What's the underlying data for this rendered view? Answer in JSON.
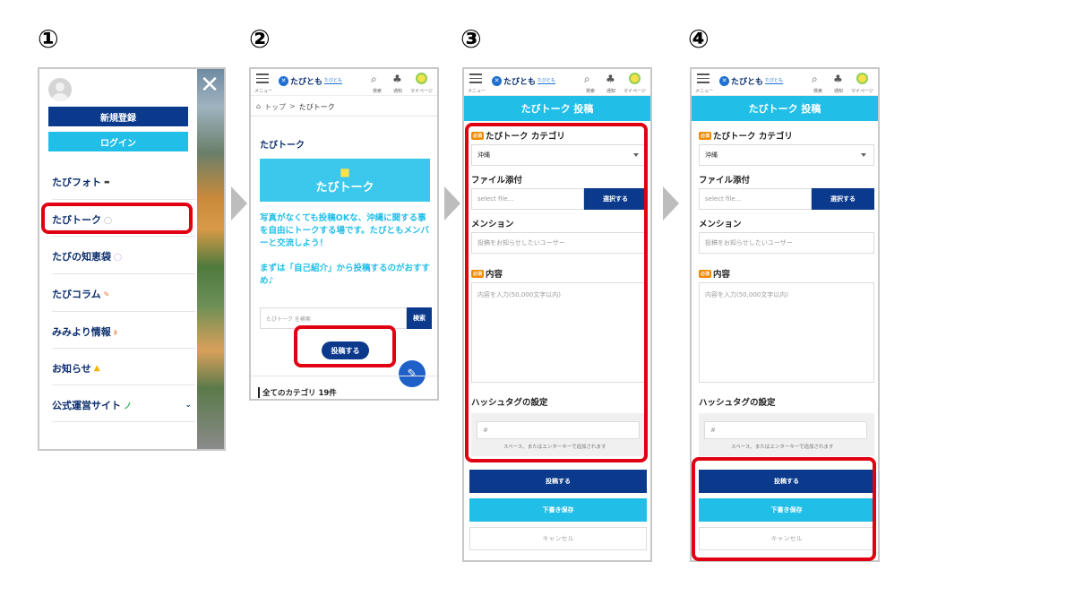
{
  "steps": [
    "①",
    "②",
    "③",
    "④"
  ],
  "panel1": {
    "signup_label": "新規登録",
    "login_label": "ログイン",
    "menu_items": [
      {
        "label": "たびフォト",
        "icon": "camera-icon"
      },
      {
        "label": "たびトーク",
        "icon": "speech-bubble-icon"
      },
      {
        "label": "たびの知恵袋",
        "icon": "bubble-icon"
      },
      {
        "label": "たびコラム",
        "icon": "pen-icon"
      },
      {
        "label": "みみより情報",
        "icon": "ear-icon"
      },
      {
        "label": "お知らせ",
        "icon": "bell-icon"
      },
      {
        "label": "公式運営サイト",
        "icon": "leaf-icon"
      }
    ],
    "close_icon": "close-icon"
  },
  "header": {
    "menu_label": "メニュー",
    "logo_text": "たびとも",
    "logo_sub": "たびとも",
    "search_label": "検索",
    "notify_label": "通知",
    "mypage_label": "マイページ"
  },
  "panel2": {
    "breadcrumb_home": "トップ",
    "breadcrumb_sep": ">",
    "breadcrumb_current": "たびトーク",
    "section_title": "たびトーク",
    "banner_text": "たびトーク",
    "description": "写真がなくても投稿OKな、沖縄に関する事を自由にトークする場です。たびともメンバーと交流しよう！",
    "description2": "まずは「自己紹介」から投稿するのがおすすめ♪",
    "search_placeholder": "たびトーク を検索",
    "search_button": "検索",
    "post_button": "投稿する",
    "category_heading": "全てのカテゴリ 19件"
  },
  "form": {
    "title": "たびトーク 投稿",
    "required_badge": "必須",
    "category_label": "たびトーク カテゴリ",
    "category_value": "沖縄",
    "file_label": "ファイル添付",
    "file_placeholder": "select file...",
    "file_button": "選択する",
    "mention_label": "メンション",
    "mention_placeholder": "投稿をお知らせしたいユーザー",
    "content_label": "内容",
    "content_placeholder": "内容を入力(50,000文字以内)",
    "hashtag_label": "ハッシュタグの設定",
    "hashtag_placeholder": "#",
    "hashtag_hint": "スペース、またはエンターキーで追加されます",
    "submit_button": "投稿する",
    "draft_button": "下書き保存",
    "cancel_button": "キャンセル"
  },
  "colors": {
    "accent": "#21bfe8",
    "navy": "#0b3a8c",
    "highlight": "#e00012"
  }
}
